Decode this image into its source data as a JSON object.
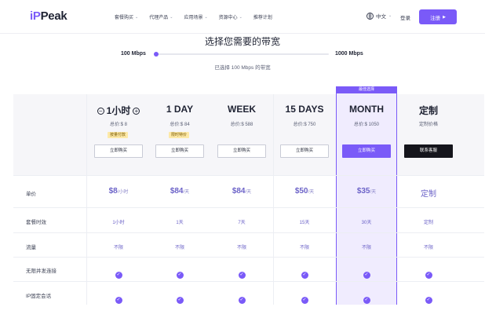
{
  "header": {
    "logo_ip": "iP",
    "logo_rest": "Peak",
    "nav": [
      {
        "label": "套餐购买"
      },
      {
        "label": "代理产品"
      },
      {
        "label": "应用场景"
      },
      {
        "label": "资源中心"
      },
      {
        "label": "推荐计划"
      }
    ],
    "language": "中文",
    "login": "登录",
    "register": "注册"
  },
  "bandwidth": {
    "title": "选择您需要的带宽",
    "min_label": "100 Mbps",
    "max_label": "1000 Mbps",
    "selected_text": "已选择 100 Mbps 的带宽",
    "slider_fraction": 0
  },
  "plans": [
    {
      "name": "1小时",
      "total": "总价:$ 8",
      "badge": "按量付款",
      "button": "立即购买",
      "price": "$8",
      "unit": "/小时",
      "duration": "1小时",
      "traffic": "不限"
    },
    {
      "name": "1 DAY",
      "total": "总价:$ 84",
      "badge": "限时特价",
      "button": "立即购买",
      "price": "$84",
      "unit": "/天",
      "duration": "1天",
      "traffic": "不限"
    },
    {
      "name": "WEEK",
      "total": "总价:$ 588",
      "badge": "",
      "button": "立即购买",
      "price": "$84",
      "unit": "/天",
      "duration": "7天",
      "traffic": "不限"
    },
    {
      "name": "15 DAYS",
      "total": "总价:$ 750",
      "badge": "",
      "button": "立即购买",
      "price": "$50",
      "unit": "/天",
      "duration": "15天",
      "traffic": "不限"
    },
    {
      "name": "MONTH",
      "total": "总价:$ 1050",
      "badge": "",
      "button": "立即购买",
      "price": "$35",
      "unit": "/天",
      "duration": "30天",
      "traffic": "不限",
      "tag": "最佳选择"
    },
    {
      "name": "定制",
      "total": "定制价格",
      "badge": "",
      "button": "联系客服",
      "price": "定制",
      "unit": "",
      "duration": "定制",
      "traffic": "不限"
    }
  ],
  "row_labels": {
    "price": "单价",
    "duration": "套餐时效",
    "traffic": "流量",
    "unlimited": "无限并发连接",
    "fixed_ip": "IP固定会话"
  },
  "colors": {
    "accent": "#7a5af8",
    "highlight_bg": "#f0ecfe",
    "badge_bg": "#fde9a8"
  }
}
